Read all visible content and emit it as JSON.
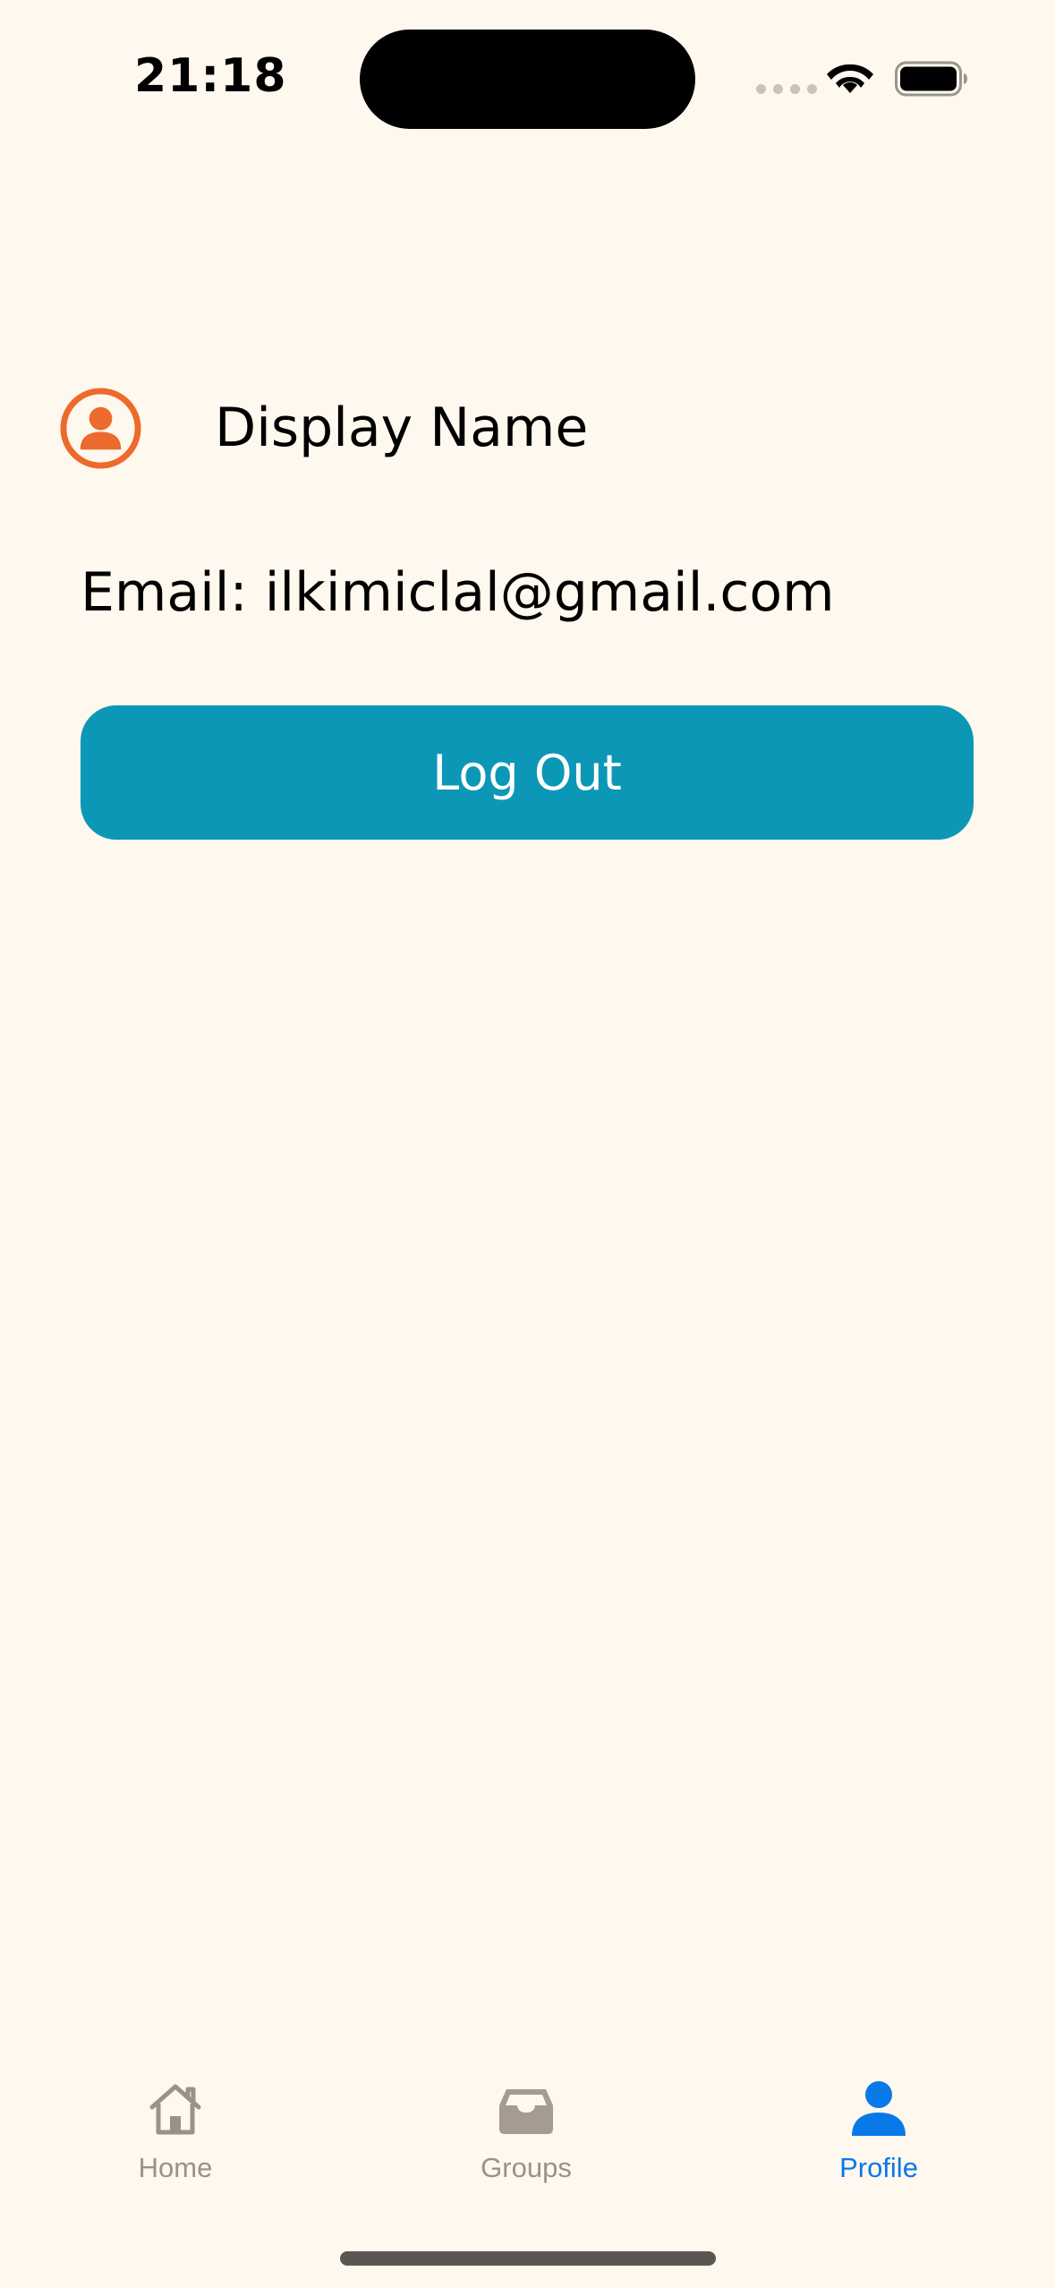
{
  "status_bar": {
    "time": "21:18"
  },
  "profile": {
    "display_name": "Display Name",
    "email": "Email: ilkimiclal@gmail.com",
    "logout_label": "Log Out"
  },
  "tab_bar": {
    "items": [
      {
        "label": "Home",
        "icon": "house-icon",
        "active": false
      },
      {
        "label": "Groups",
        "icon": "tray-icon",
        "active": false
      },
      {
        "label": "Profile",
        "icon": "person-icon",
        "active": true
      }
    ]
  },
  "colors": {
    "background": "#FFF8EE",
    "accent_orange": "#EC6A2B",
    "button_teal": "#0C97B7",
    "tab_active": "#0A79E8",
    "tab_inactive": "#99928a"
  }
}
